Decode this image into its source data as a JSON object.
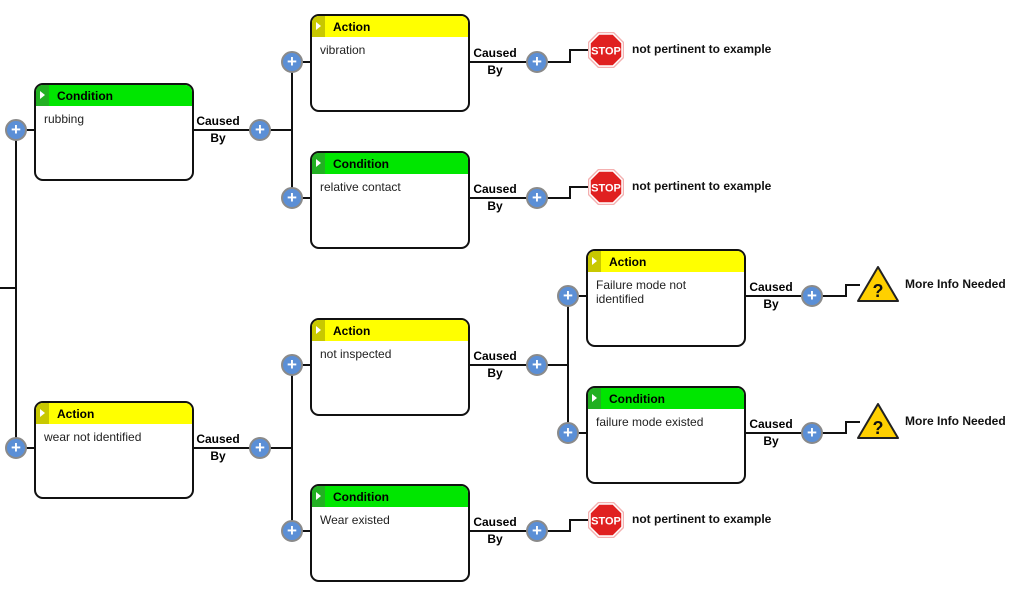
{
  "caused_by": {
    "line1": "Caused",
    "line2": "By"
  },
  "nodes": [
    {
      "type": "Condition",
      "text": "rubbing"
    },
    {
      "type": "Action",
      "text": "wear not identified"
    },
    {
      "type": "Action",
      "text": "vibration"
    },
    {
      "type": "Condition",
      "text": "relative contact"
    },
    {
      "type": "Action",
      "text": "not inspected"
    },
    {
      "type": "Condition",
      "text": "Wear existed"
    },
    {
      "type": "Action",
      "text": "Failure mode not identified"
    },
    {
      "type": "Condition",
      "text": "failure mode existed"
    }
  ],
  "terminals": [
    {
      "icon": "stop-sign-icon",
      "sign_text": "STOP",
      "label": "not pertinent to example"
    },
    {
      "icon": "stop-sign-icon",
      "sign_text": "STOP",
      "label": "not pertinent to example"
    },
    {
      "icon": "stop-sign-icon",
      "sign_text": "STOP",
      "label": "not pertinent to example"
    },
    {
      "icon": "warning-question-icon",
      "sign_text": "?",
      "label": "More Info Needed"
    },
    {
      "icon": "warning-question-icon",
      "sign_text": "?",
      "label": "More Info Needed"
    }
  ],
  "colors": {
    "condition": "#00e600",
    "action": "#ffff00",
    "plus": "#5b8fd6",
    "stop": "#e02020",
    "warning": "#ffd000"
  }
}
